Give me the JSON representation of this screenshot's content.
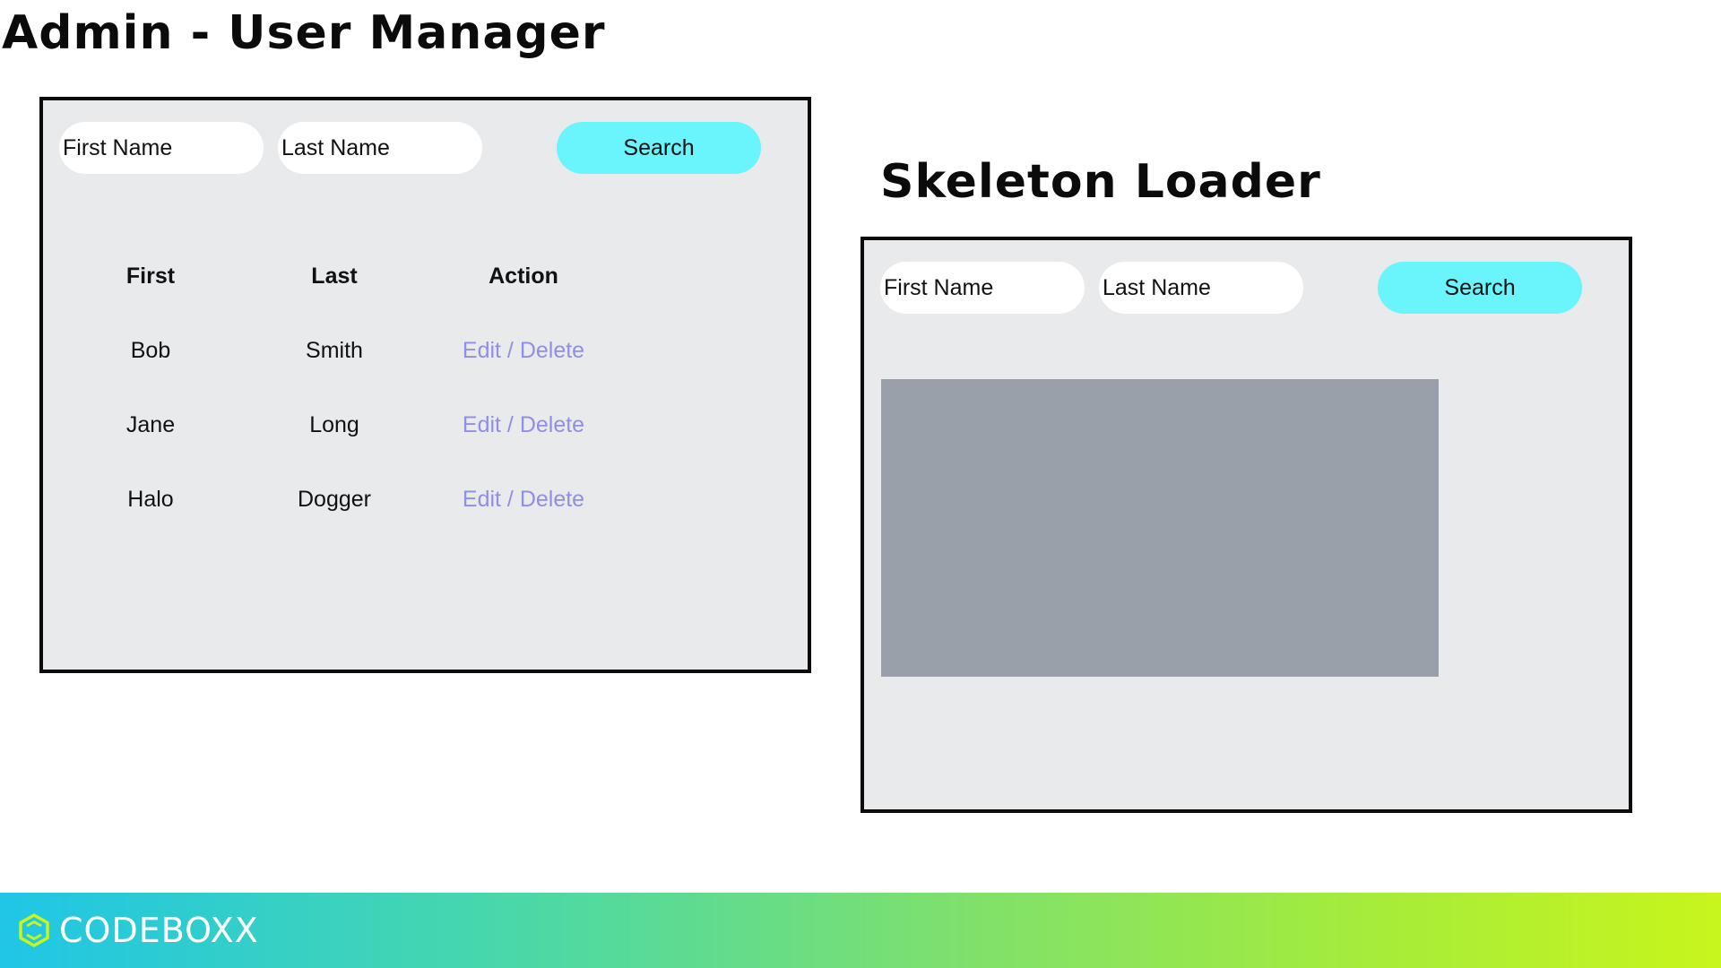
{
  "main": {
    "title": "Admin - User Manager",
    "search_form": {
      "first_name_placeholder": "First Name",
      "last_name_placeholder": "Last Name",
      "search_label": "Search"
    },
    "table": {
      "headers": [
        "First",
        "Last",
        "Action"
      ],
      "rows": [
        {
          "first": "Bob",
          "last": "Smith",
          "action": "Edit / Delete"
        },
        {
          "first": "Jane",
          "last": "Long",
          "action": "Edit / Delete"
        },
        {
          "first": "Halo",
          "last": "Dogger",
          "action": "Edit / Delete"
        }
      ]
    }
  },
  "skeleton": {
    "title": "Skeleton Loader",
    "search_form": {
      "first_name_placeholder": "First Name",
      "last_name_placeholder": "Last Name",
      "search_label": "Search"
    }
  },
  "footer": {
    "brand": "CODEBOXX",
    "logo_icon": "hexagon-logo-icon"
  },
  "colors": {
    "search_button": "#6af4fb",
    "panel_background": "#e9eaec",
    "action_link": "#8f8fe4",
    "skeleton_block": "#99a0aa",
    "footer_gradient_start": "#1fc6e6",
    "footer_gradient_end": "#c8f51c"
  }
}
